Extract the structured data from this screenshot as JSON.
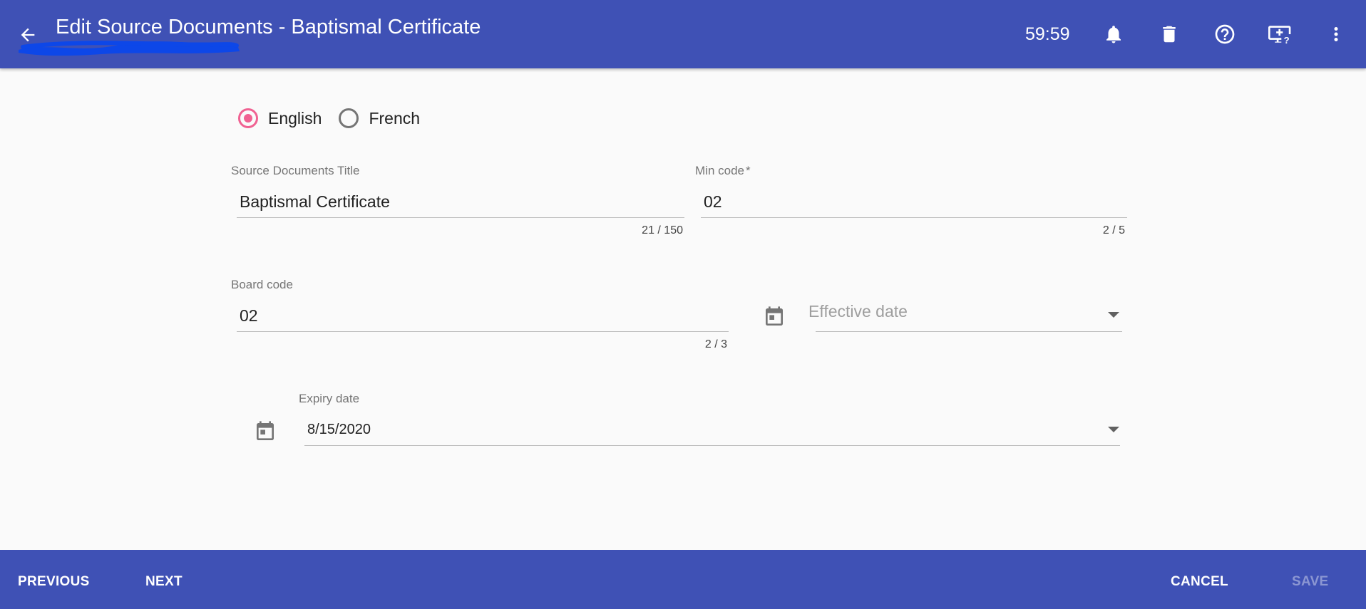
{
  "header": {
    "title": "Edit Source Documents - Baptismal Certificate",
    "timer": "59:59",
    "icons": [
      "back-arrow-icon",
      "bell-icon",
      "trash-icon",
      "help-icon",
      "monitor-help-icon",
      "more-vert-icon"
    ]
  },
  "language": {
    "options": [
      {
        "label": "English",
        "selected": true
      },
      {
        "label": "French",
        "selected": false
      }
    ]
  },
  "form": {
    "title_field": {
      "label": "Source Documents Title",
      "value": "Baptismal Certificate",
      "counter": "21 / 150"
    },
    "min_code": {
      "label": "Min code",
      "required_mark": "*",
      "value": "02",
      "counter": "2 / 5"
    },
    "board_code": {
      "label": "Board code",
      "value": "02",
      "counter": "2 / 3"
    },
    "effective_date": {
      "placeholder": "Effective date",
      "value": ""
    },
    "expiry_date": {
      "label": "Expiry date",
      "value": "8/15/2020"
    }
  },
  "footer": {
    "previous_label": "PREVIOUS",
    "next_label": "NEXT",
    "cancel_label": "CANCEL",
    "save_label": "SAVE"
  },
  "colors": {
    "primary": "#3f51b5",
    "accent": "#f06292",
    "redaction": "#0d47e8"
  }
}
